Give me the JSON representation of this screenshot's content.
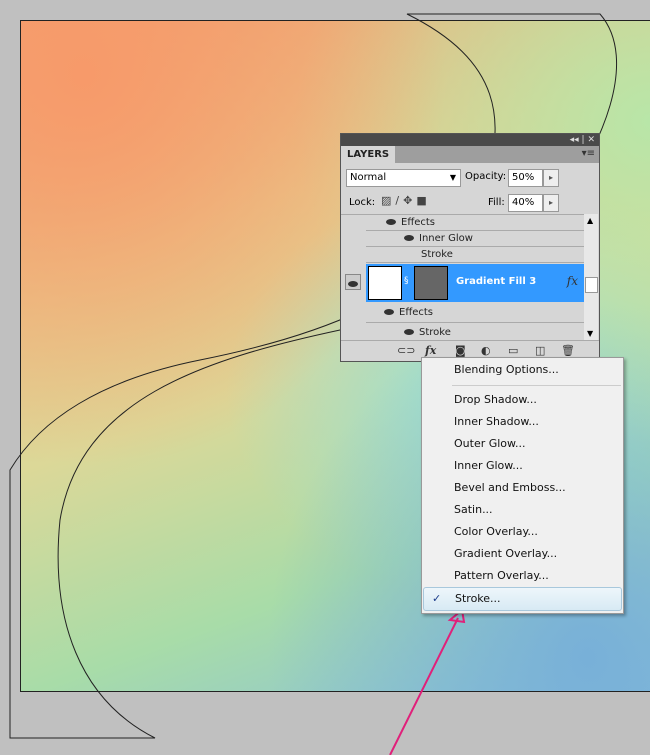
{
  "panel": {
    "title": "LAYERS",
    "blend_mode": "Normal",
    "opacity_label": "Opacity:",
    "opacity": "50%",
    "lock_label": "Lock:",
    "fill_label": "Fill:",
    "fill": "40%",
    "layers": [
      {
        "label": "Effects"
      },
      {
        "label": "Inner Glow"
      },
      {
        "label": "Stroke"
      }
    ],
    "selected_layer": {
      "name": "Gradient Fill 3",
      "fx": "fx"
    },
    "sub": [
      {
        "label": "Effects"
      },
      {
        "label": "Stroke"
      }
    ],
    "fx_button": "fx"
  },
  "menu": {
    "items": [
      {
        "label": "Blending Options..."
      },
      {
        "label": "Drop Shadow..."
      },
      {
        "label": "Inner Shadow..."
      },
      {
        "label": "Outer Glow..."
      },
      {
        "label": "Inner Glow..."
      },
      {
        "label": "Bevel and Emboss..."
      },
      {
        "label": "Satin..."
      },
      {
        "label": "Color Overlay..."
      },
      {
        "label": "Gradient Overlay..."
      },
      {
        "label": "Pattern Overlay..."
      },
      {
        "label": "Stroke..."
      }
    ],
    "checked": "Stroke...",
    "check_glyph": "✓"
  },
  "colors": {
    "selection": "#3399ff",
    "arrow": "#e0207a"
  }
}
